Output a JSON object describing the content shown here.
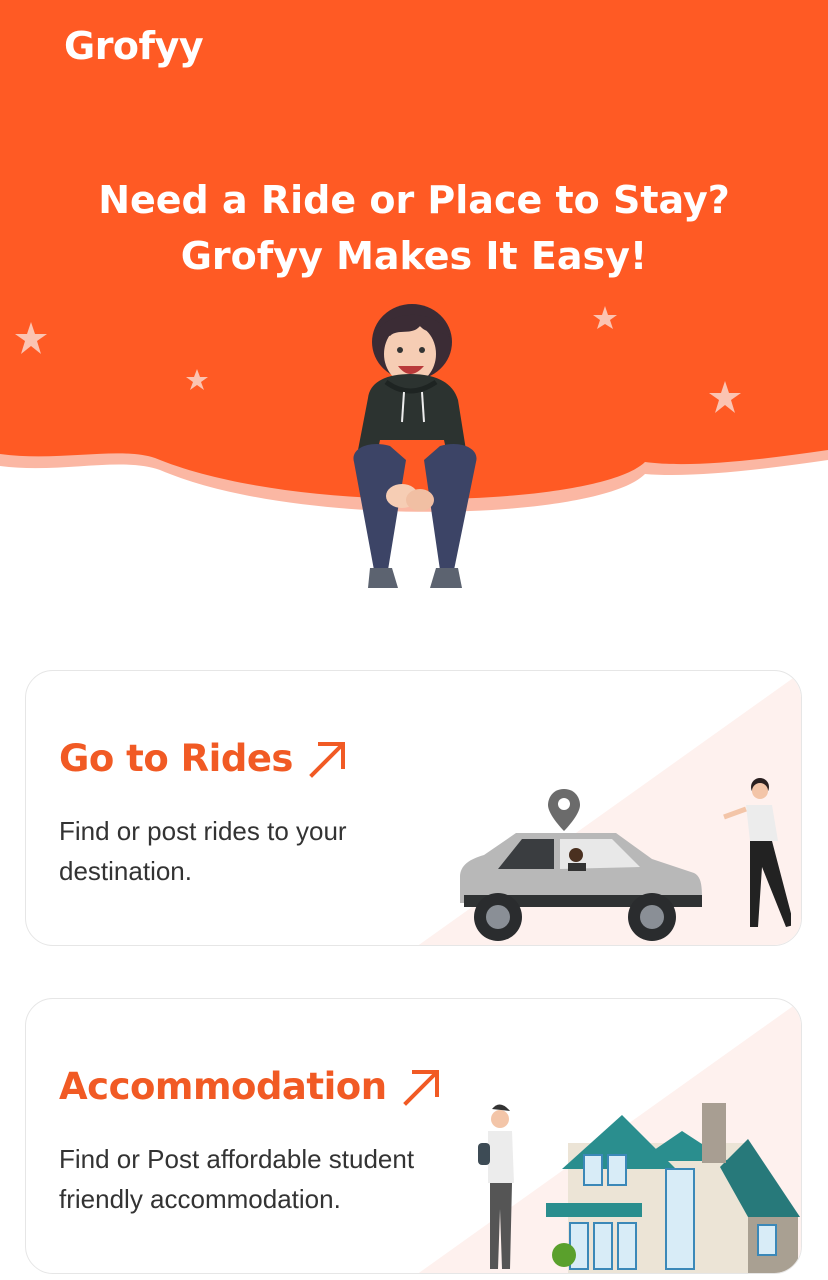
{
  "app": {
    "name": "Grofyy"
  },
  "colors": {
    "brand": "#ff5a24",
    "brand_light": "#fde9e3",
    "card_tint": "#fef1ee"
  },
  "hero": {
    "headline_line1": "Need a Ride or Place to Stay?",
    "headline_line2": "Grofyy Makes It Easy!",
    "illustration": "sitting-boy-illustration"
  },
  "cards": [
    {
      "title": "Go to Rides",
      "description_line1": "Find or post rides to your",
      "description_line2": "destination.",
      "icon": "arrow-up-right-icon",
      "illustration": "car-ride-illustration"
    },
    {
      "title": "Accommodation",
      "description_line1": "Find or Post affordable student",
      "description_line2": "friendly accommodation.",
      "icon": "arrow-up-right-icon",
      "illustration": "house-illustration"
    }
  ]
}
